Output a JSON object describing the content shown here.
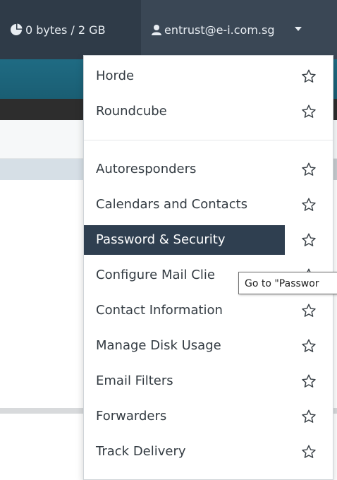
{
  "header": {
    "disk_usage": "0 bytes / 2 GB",
    "disk_icon": "pie-chart-icon",
    "user_email": "entrust@e-i.com.sg",
    "user_icon": "user-icon",
    "caret_icon": "caret-down-icon"
  },
  "dropdown": {
    "webmail_items": [
      {
        "label": "Horde",
        "icon": "star-icon"
      },
      {
        "label": "Roundcube",
        "icon": "star-icon"
      }
    ],
    "items": [
      {
        "label": "Autoresponders",
        "icon": "star-icon"
      },
      {
        "label": "Calendars and Contacts",
        "icon": "star-icon"
      },
      {
        "label": "Password & Security",
        "icon": "star-icon",
        "active": true
      },
      {
        "label": "Configure Mail Clie",
        "icon": "star-icon"
      },
      {
        "label": "Contact Information",
        "icon": "star-icon"
      },
      {
        "label": "Manage Disk Usage",
        "icon": "star-icon"
      },
      {
        "label": "Email Filters",
        "icon": "star-icon"
      },
      {
        "label": "Forwarders",
        "icon": "star-icon"
      },
      {
        "label": "Track Delivery",
        "icon": "star-icon"
      }
    ]
  },
  "tooltip": {
    "text": "Go to \"Passwor"
  },
  "colors": {
    "topbar": "#2f3b48",
    "active_item": "#2f3f50",
    "teal_band": "#1f6b83"
  }
}
